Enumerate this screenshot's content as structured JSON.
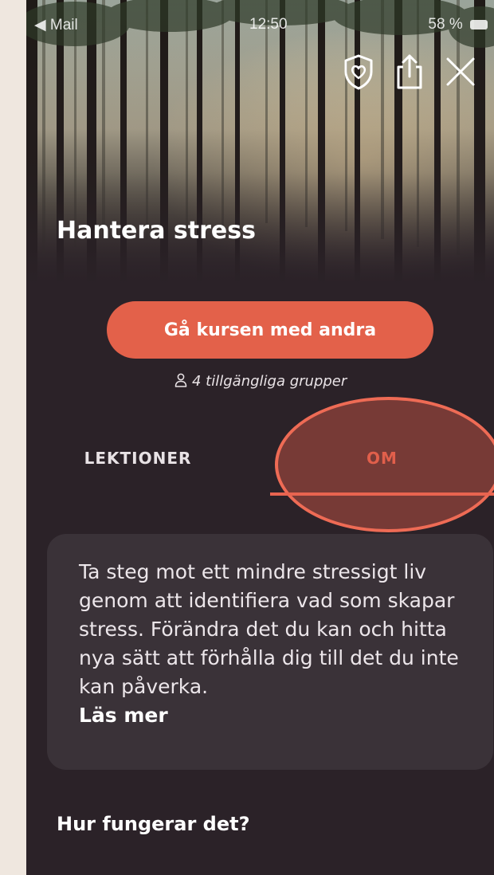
{
  "status_bar": {
    "back_app": "◀ Mail",
    "time": "12:50",
    "battery": "58 %"
  },
  "header": {
    "icons": [
      "shield-heart-icon",
      "share-icon",
      "close-icon"
    ]
  },
  "course": {
    "title": "Hantera stress",
    "join_button": "Gå kursen med andra",
    "groups_text": "4 tillgängliga grupper"
  },
  "tabs": [
    {
      "label": "LEKTIONER",
      "active": false
    },
    {
      "label": "OM",
      "active": true
    }
  ],
  "about": {
    "description": "Ta steg mot ett mindre stressigt liv genom att identifiera vad som skapar stress. Förändra det du kan och hitta nya sätt att förhålla dig till det du inte kan påverka.",
    "read_more": "Läs mer"
  },
  "section": {
    "title": "Hur fungerar det?"
  },
  "colors": {
    "accent": "#e3614a",
    "background": "#2b2228",
    "card": "#3a3238"
  }
}
